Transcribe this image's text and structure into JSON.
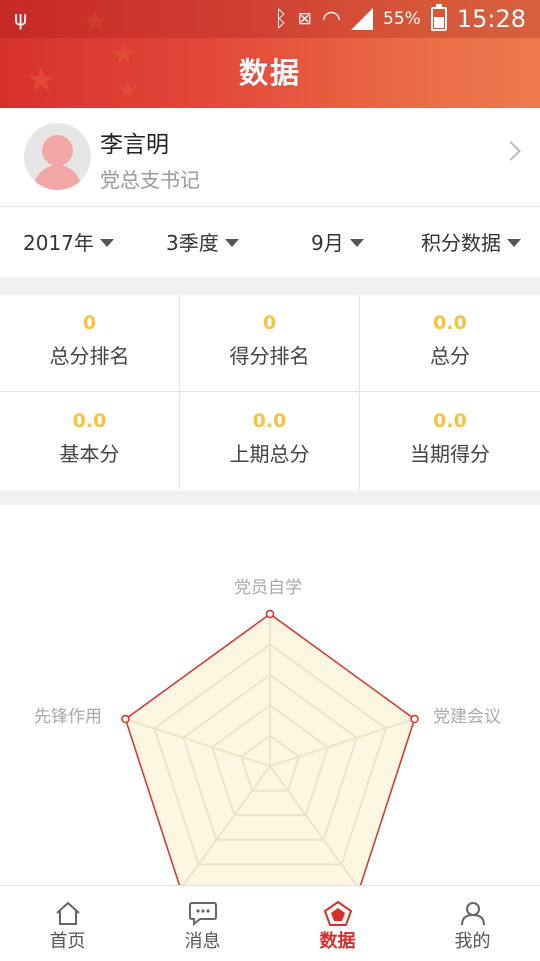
{
  "status": {
    "battery": "55%",
    "time": "15:28"
  },
  "header": {
    "title": "数据"
  },
  "profile": {
    "name": "李言明",
    "role": "党总支书记"
  },
  "filters": [
    {
      "label": "2017年"
    },
    {
      "label": "3季度"
    },
    {
      "label": "9月"
    },
    {
      "label": "积分数据"
    }
  ],
  "stats": [
    {
      "value": "0",
      "label": "总分排名"
    },
    {
      "value": "0",
      "label": "得分排名"
    },
    {
      "value": "0.0",
      "label": "总分"
    },
    {
      "value": "0.0",
      "label": "基本分"
    },
    {
      "value": "0.0",
      "label": "上期总分"
    },
    {
      "value": "0.0",
      "label": "当期得分"
    }
  ],
  "radar": {
    "axes": [
      "党员自学",
      "党建会议",
      "先锋作用"
    ],
    "fill_color": "#fdf6e0",
    "line_color": "#d7302c"
  },
  "nav": [
    {
      "label": "首页",
      "icon": "home-icon"
    },
    {
      "label": "消息",
      "icon": "message-icon"
    },
    {
      "label": "数据",
      "icon": "data-icon"
    },
    {
      "label": "我的",
      "icon": "profile-icon"
    }
  ],
  "colors": {
    "accent": "#d7302c",
    "value_yellow": "#f5c242"
  }
}
